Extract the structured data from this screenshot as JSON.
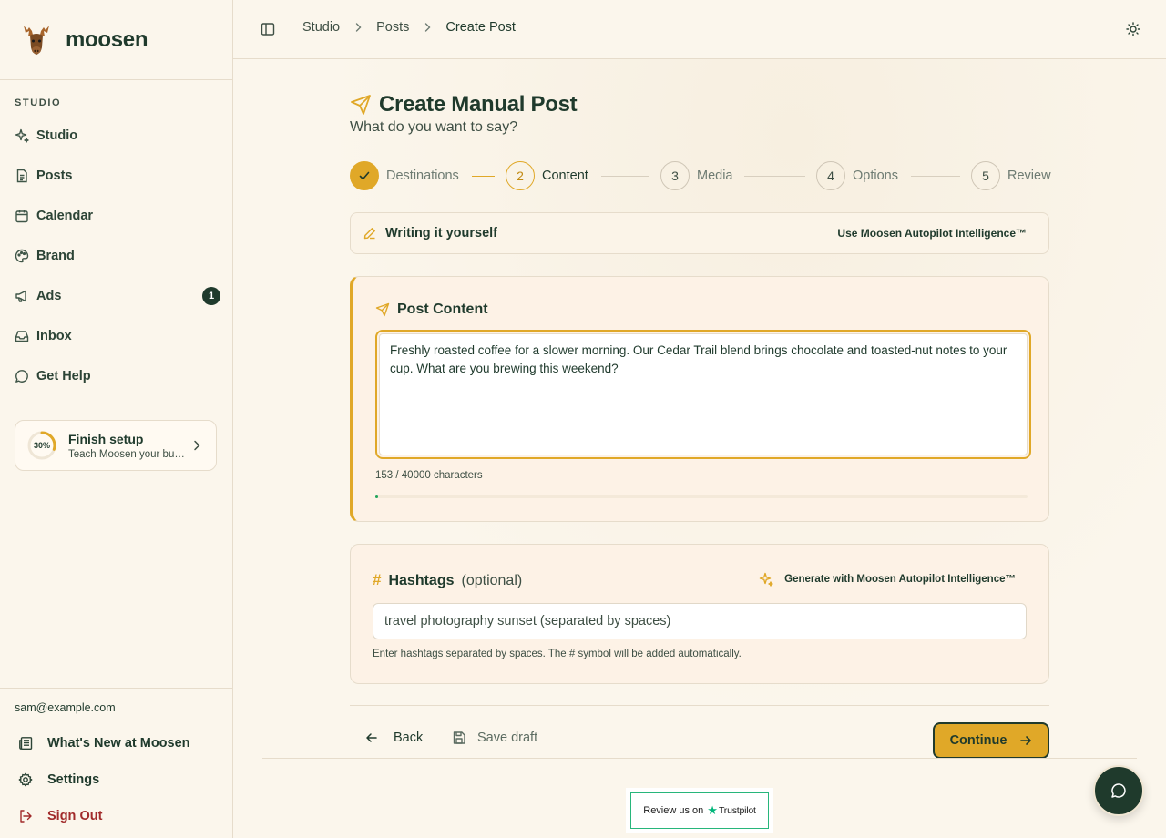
{
  "brand": {
    "name": "moosen"
  },
  "sidebar": {
    "section_label": "STUDIO",
    "items": [
      {
        "label": "Studio",
        "icon": "sparkles-icon"
      },
      {
        "label": "Posts",
        "icon": "file-text-icon"
      },
      {
        "label": "Calendar",
        "icon": "calendar-icon"
      },
      {
        "label": "Brand",
        "icon": "palette-icon"
      },
      {
        "label": "Ads",
        "icon": "megaphone-icon",
        "badge": "1"
      },
      {
        "label": "Inbox",
        "icon": "inbox-icon"
      },
      {
        "label": "Get Help",
        "icon": "message-circle-icon"
      }
    ],
    "setup": {
      "progress_label": "30%",
      "progress": 0.3,
      "title": "Finish setup",
      "subtitle": "Teach Moosen your business"
    },
    "user_email": "sam@example.com",
    "footer": {
      "whats_new": "What's New at Moosen",
      "settings": "Settings",
      "sign_out": "Sign Out"
    }
  },
  "header": {
    "breadcrumbs": [
      "Studio",
      "Posts",
      "Create Post"
    ]
  },
  "page": {
    "title": "Create Manual Post",
    "subtitle": "What do you want to say?"
  },
  "stepper": {
    "steps": [
      {
        "number": "1",
        "label": "Destinations",
        "state": "done"
      },
      {
        "number": "2",
        "label": "Content",
        "state": "active"
      },
      {
        "number": "3",
        "label": "Media",
        "state": "pending"
      },
      {
        "number": "4",
        "label": "Options",
        "state": "pending"
      },
      {
        "number": "5",
        "label": "Review",
        "state": "pending"
      }
    ]
  },
  "mode": {
    "label": "Writing it yourself",
    "switch_label": "Use Moosen Autopilot Intelligence™"
  },
  "post_content": {
    "title": "Post Content",
    "text": "Freshly roasted coffee for a slower morning. Our Cedar Trail blend brings chocolate and toasted-nut notes to your cup. What are you brewing this weekend?",
    "char_count": "153 / 40000 characters",
    "char_fraction": 0.0038
  },
  "hashtags": {
    "symbol": "#",
    "title": "Hashtags",
    "optional": "(optional)",
    "generate_label": "Generate with Moosen Autopilot Intelligence™",
    "placeholder": "travel photography sunset (separated by spaces)",
    "help": "Enter hashtags separated by spaces. The # symbol will be added automatically."
  },
  "actions": {
    "back": "Back",
    "save_draft": "Save draft",
    "continue": "Continue"
  },
  "trustpilot": {
    "prefix": "Review us on",
    "brand": "Trustpilot"
  },
  "colors": {
    "accent": "#e0a828",
    "primary": "#1f3a2c",
    "background": "#fbf6ec",
    "danger": "#a12b2b",
    "success": "#22a55c"
  }
}
